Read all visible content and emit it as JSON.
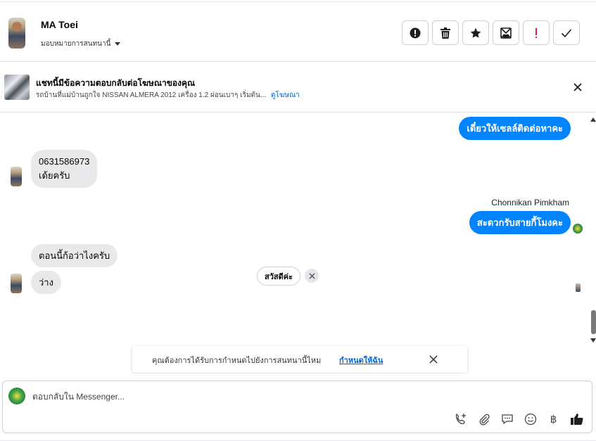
{
  "header": {
    "contact_name": "MA Toei",
    "assign_label": "มอบหมายการสนทนานี้",
    "actions": [
      {
        "name": "spam-button",
        "icon": "alert-circle-icon"
      },
      {
        "name": "delete-button",
        "icon": "trash-icon"
      },
      {
        "name": "star-button",
        "icon": "star-icon"
      },
      {
        "name": "mark-unread-button",
        "icon": "envelope-icon"
      },
      {
        "name": "follow-up-button",
        "icon": "exclamation-icon"
      },
      {
        "name": "done-button",
        "icon": "check-icon"
      }
    ]
  },
  "ad_banner": {
    "title": "แชทนี้มีข้อความตอบกลับต่อโฆษณาของคุณ",
    "subtitle": "รถบ้านที่แม่บ้านถูกใจ NISSAN ALMERA 2012 เครื่อง 1.2 ผ่อนเบาๆ เริ่มต้น...",
    "link_label": "ดูโฆษณา"
  },
  "messages": [
    {
      "direction": "out",
      "text": "เดี๋ยวให้เซลล์ติดต่อหาคะ"
    },
    {
      "direction": "in",
      "lines": [
        "0631586973",
        "เด้ยครับ"
      ]
    },
    {
      "direction": "out",
      "sender": "Chonnikan Pimkham",
      "text": "สะดวกรับสายกี้โมงคะ"
    },
    {
      "direction": "in",
      "text": "ตอนนี้ก้อว่าไงครับ"
    },
    {
      "direction": "in",
      "text": "ว่าง"
    }
  ],
  "quick_reply": {
    "label": "สวัสดีค่ะ"
  },
  "toast": {
    "text": "คุณต้องการได้รับการกำหนดไปยังการสนทนานี้ไหม",
    "link_label": "กำหนดให้ฉัน"
  },
  "composer": {
    "placeholder": "ตอบกลับใน Messenger...",
    "tools": [
      "call-add-icon",
      "paperclip-icon",
      "chat-bubble-icon",
      "smiley-icon",
      "baht-icon",
      "thumbs-up-icon"
    ],
    "baht_symbol": "฿"
  },
  "colors": {
    "outgoing_bubble": "#0084ff",
    "incoming_bubble": "#e9e9eb",
    "link": "#0064d1"
  }
}
